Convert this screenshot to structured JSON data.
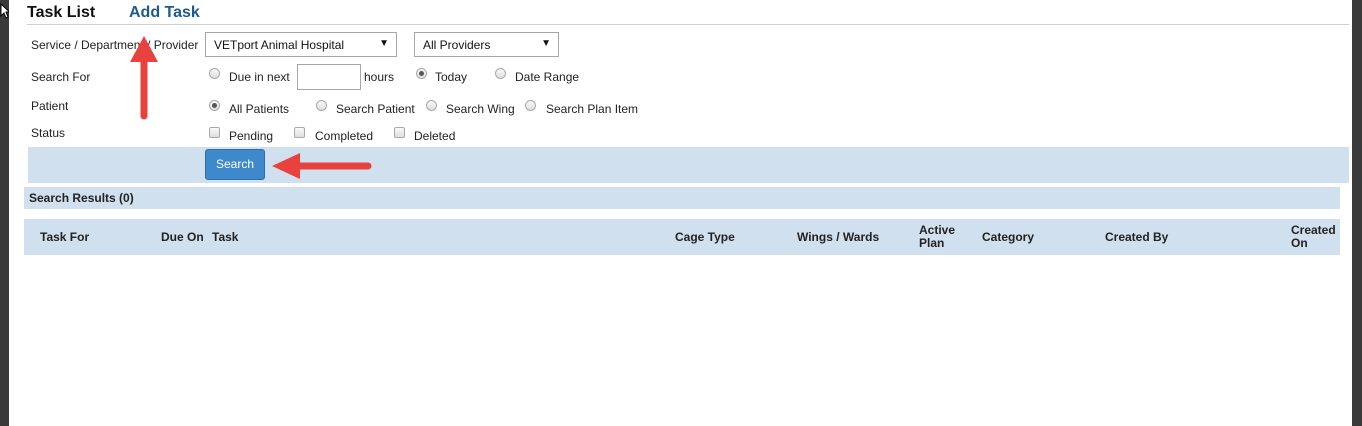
{
  "header": {
    "title": "Task List",
    "add_task": "Add Task"
  },
  "filters": {
    "service_label": "Service / Department / Provider",
    "service_select": "VETport Animal Hospital",
    "provider_select": "All Providers",
    "search_for_label": "Search For",
    "due_in_next": "Due in next",
    "hours_value": "",
    "hours": "hours",
    "today": "Today",
    "date_range": "Date Range",
    "patient_label": "Patient",
    "all_patients": "All Patients",
    "search_patient": "Search Patient",
    "search_wing": "Search Wing",
    "search_plan_item": "Search Plan Item",
    "status_label": "Status",
    "pending": "Pending",
    "completed": "Completed",
    "deleted": "Deleted"
  },
  "search_button": "Search",
  "results": {
    "title": "Search Results (0)"
  },
  "table": {
    "columns": [
      "Task For",
      "Due On",
      "Task",
      "Cage Type",
      "Wings / Wards",
      "Active Plan",
      "Category",
      "Created By",
      "Created On"
    ]
  },
  "annotation_color": "#e8423f"
}
